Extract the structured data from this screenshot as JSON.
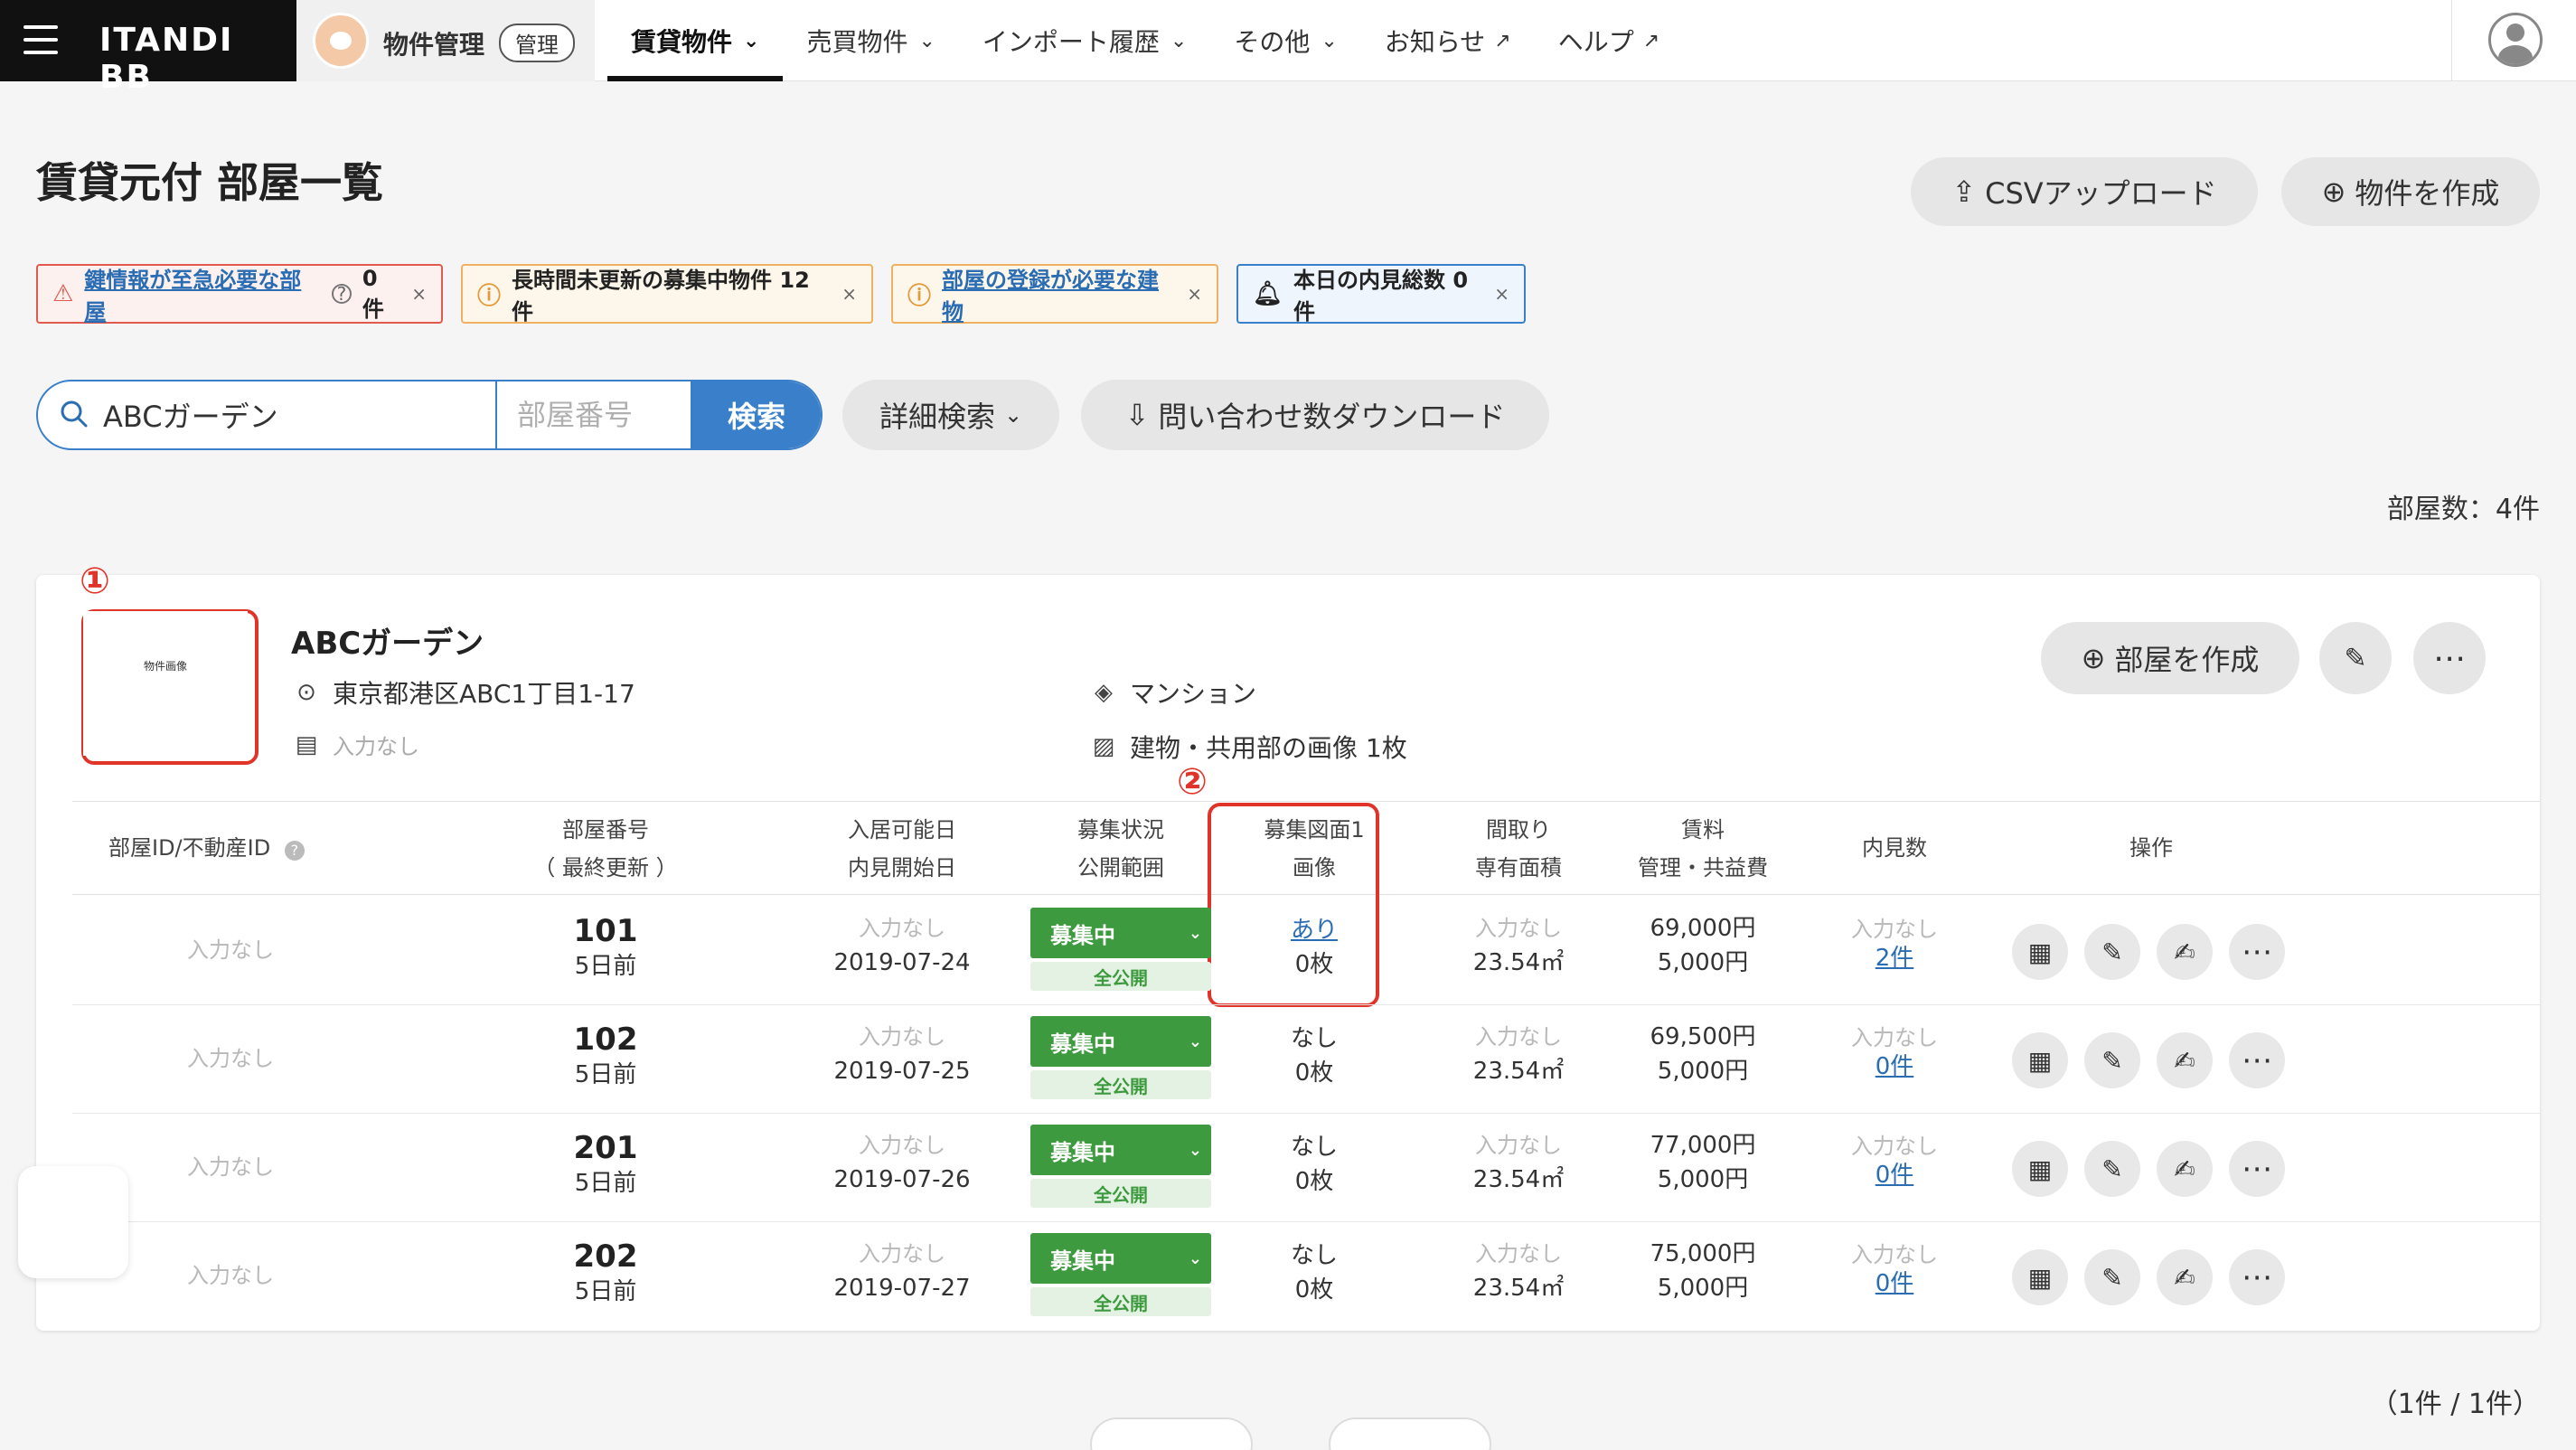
{
  "topbar": {
    "brand": "ITANDI BB",
    "product": "物件管理",
    "product_badge": "管理",
    "nav": [
      {
        "label": "賃貸物件",
        "active": true,
        "type": "dropdown"
      },
      {
        "label": "売買物件",
        "type": "dropdown"
      },
      {
        "label": "インポート履歴",
        "type": "dropdown"
      },
      {
        "label": "その他",
        "type": "dropdown"
      },
      {
        "label": "お知らせ",
        "type": "external"
      },
      {
        "label": "ヘルプ",
        "type": "external"
      }
    ]
  },
  "page": {
    "title": "賃貸元付 部屋一覧",
    "csv_upload": "CSVアップロード",
    "create_property": "物件を作成"
  },
  "alerts": [
    {
      "label": "鍵情報が至急必要な部屋",
      "count": "0件",
      "tone": "red"
    },
    {
      "label": "長時間未更新の募集中物件 12件",
      "tone": "orange"
    },
    {
      "label": "部屋の登録が必要な建物",
      "tone": "orange"
    },
    {
      "label": "本日の内見総数 0件",
      "tone": "blue"
    }
  ],
  "search": {
    "value": "ABCガーデン",
    "room_placeholder": "部屋番号",
    "button": "検索",
    "advanced": "詳細検索",
    "download": "問い合わせ数ダウンロード"
  },
  "room_count": "部屋数：4件",
  "markers": {
    "one": "①",
    "two": "②"
  },
  "building": {
    "thumbnail_label": "物件画像",
    "name": "ABCガーデン",
    "address": "東京都港区ABC1丁目1-17",
    "note": "入力なし",
    "type": "マンション",
    "images": "建物・共用部の画像 1枚",
    "create_room": "部屋を作成"
  },
  "table": {
    "headers": {
      "room_id": "部屋ID/不動産ID",
      "room_no_1": "部屋番号",
      "room_no_2": "（ 最終更新 ）",
      "avail_1": "入居可能日",
      "avail_2": "内見開始日",
      "status_1": "募集状況",
      "status_2": "公開範囲",
      "plan_1": "募集図面1",
      "plan_2": "画像",
      "layout_1": "間取り",
      "layout_2": "専有面積",
      "rent_1": "賃料",
      "rent_2": "管理・共益費",
      "viewings": "内見数",
      "ops": "操作"
    },
    "rows": [
      {
        "room_id": "入力なし",
        "room_no": "101",
        "updated": "5日前",
        "avail": "入力なし",
        "view_start": "2019-07-24",
        "status": "募集中",
        "scope": "全公開",
        "plan": "あり",
        "plan_link": true,
        "images": "0枚",
        "layout": "入力なし",
        "area": "23.54㎡",
        "rent": "69,000円",
        "fee": "5,000円",
        "view_note": "入力なし",
        "view_count": "2件"
      },
      {
        "room_id": "入力なし",
        "room_no": "102",
        "updated": "5日前",
        "avail": "入力なし",
        "view_start": "2019-07-25",
        "status": "募集中",
        "scope": "全公開",
        "plan": "なし",
        "plan_link": false,
        "images": "0枚",
        "layout": "入力なし",
        "area": "23.54㎡",
        "rent": "69,500円",
        "fee": "5,000円",
        "view_note": "入力なし",
        "view_count": "0件"
      },
      {
        "room_id": "入力なし",
        "room_no": "201",
        "updated": "5日前",
        "avail": "入力なし",
        "view_start": "2019-07-26",
        "status": "募集中",
        "scope": "全公開",
        "plan": "なし",
        "plan_link": false,
        "images": "0枚",
        "layout": "入力なし",
        "area": "23.54㎡",
        "rent": "77,000円",
        "fee": "5,000円",
        "view_note": "入力なし",
        "view_count": "0件"
      },
      {
        "room_id": "入力なし",
        "room_no": "202",
        "updated": "5日前",
        "avail": "入力なし",
        "view_start": "2019-07-27",
        "status": "募集中",
        "scope": "全公開",
        "plan": "なし",
        "plan_link": false,
        "images": "0枚",
        "layout": "入力なし",
        "area": "23.54㎡",
        "rent": "75,000円",
        "fee": "5,000円",
        "view_note": "入力なし",
        "view_count": "0件"
      }
    ]
  },
  "pager": "（1件 / 1件）",
  "colors": {
    "accent": "#3a7fc9",
    "status_green": "#3e9a3e",
    "annotation_red": "#e0342a"
  }
}
